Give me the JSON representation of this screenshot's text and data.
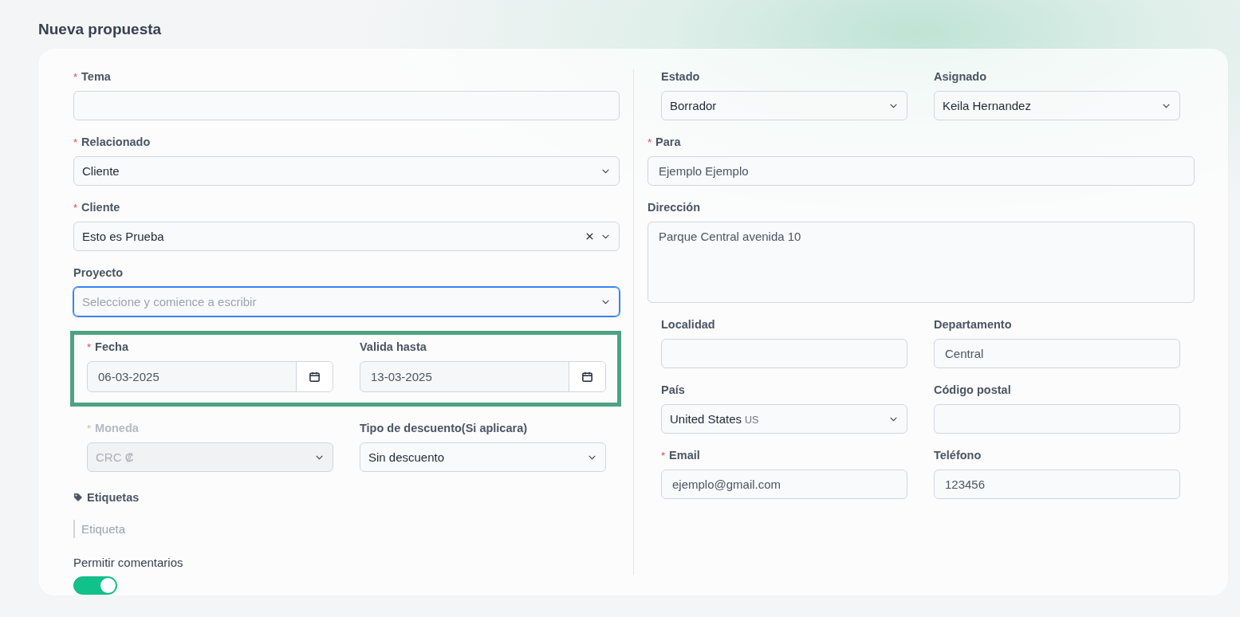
{
  "title": "Nueva propuesta",
  "left": [
    {
      "kind": "field",
      "field": {
        "label": "Tema",
        "required_mark": "*",
        "kind": "text"
      }
    },
    {
      "kind": "field",
      "field": {
        "label": "Relacionado",
        "required_mark": "*",
        "kind": "select",
        "value": "Cliente"
      }
    },
    {
      "kind": "field",
      "field": {
        "label": "Cliente",
        "required_mark": "*",
        "kind": "select",
        "value": "Esto es Prueba",
        "clearable": true
      }
    },
    {
      "kind": "field",
      "field": {
        "label": "Proyecto",
        "kind": "select",
        "placeholder": "Seleccione y comience a escribir",
        "focused": true
      }
    },
    {
      "kind": "pair",
      "highlighted": true,
      "fields": [
        {
          "label": "Fecha",
          "required_mark": "*",
          "kind": "date",
          "value": "06-03-2025"
        },
        {
          "label": "Valida hasta",
          "kind": "date",
          "value": "13-03-2025"
        }
      ]
    },
    {
      "kind": "pair",
      "highlighted": false,
      "fields": [
        {
          "label": "Moneda",
          "required_mark": "*",
          "kind": "select",
          "value": "CRC ₡",
          "disabled": true
        },
        {
          "label": "Tipo de descuento(Si aplicara)",
          "kind": "select",
          "value": "Sin descuento"
        }
      ]
    },
    {
      "kind": "tags",
      "label": "Etiquetas",
      "placeholder": "Etiqueta"
    },
    {
      "kind": "toggle",
      "label": "Permitir comentarios",
      "on": true
    }
  ],
  "right": [
    {
      "kind": "pair",
      "highlighted": false,
      "fields": [
        {
          "label": "Estado",
          "kind": "select",
          "value": "Borrador"
        },
        {
          "label": "Asignado",
          "kind": "select",
          "value": "Keila Hernandez"
        }
      ]
    },
    {
      "kind": "field",
      "field": {
        "label": "Para",
        "required_mark": "*",
        "kind": "text",
        "value": "Ejemplo Ejemplo"
      }
    },
    {
      "kind": "field",
      "field": {
        "label": "Dirección",
        "kind": "textarea",
        "value": "Parque Central avenida 10"
      }
    },
    {
      "kind": "pair",
      "highlighted": false,
      "fields": [
        {
          "label": "Localidad",
          "kind": "text"
        },
        {
          "label": "Departamento",
          "kind": "text",
          "value": "Central"
        }
      ]
    },
    {
      "kind": "pair",
      "highlighted": false,
      "fields": [
        {
          "label": "País",
          "kind": "select",
          "value": "United States",
          "code": "US"
        },
        {
          "label": "Código postal",
          "kind": "text"
        }
      ]
    },
    {
      "kind": "pair",
      "highlighted": false,
      "fields": [
        {
          "label": "Email",
          "required_mark": "*",
          "kind": "text",
          "value": "ejemplo@gmail.com"
        },
        {
          "label": "Teléfono",
          "kind": "text",
          "value": "123456"
        }
      ]
    }
  ]
}
